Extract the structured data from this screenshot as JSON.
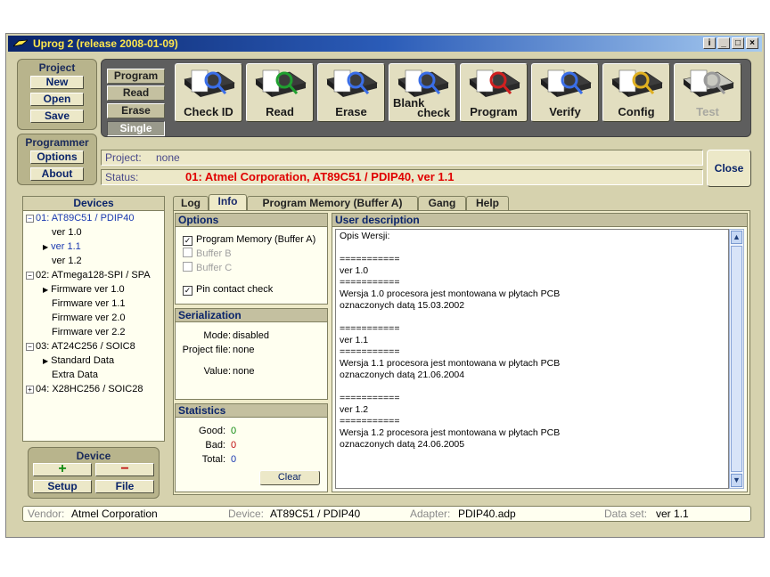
{
  "window": {
    "title": "Uprog 2 (release 2008-01-09)",
    "controls": [
      "i",
      "_",
      "□",
      "×"
    ]
  },
  "project_panel": {
    "header": "Project",
    "buttons": [
      "New",
      "Open",
      "Save"
    ]
  },
  "programmer_panel": {
    "header": "Programmer",
    "buttons": [
      "Options",
      "About"
    ]
  },
  "modes": {
    "items": [
      "Program",
      "Read",
      "Erase",
      "Single"
    ],
    "active": "Single"
  },
  "toolbar": {
    "tools": [
      {
        "label": "Check ID",
        "icon": "chip-magnifier-icon",
        "enabled": true
      },
      {
        "label": "Read",
        "icon": "chip-read-arrow-icon",
        "enabled": true
      },
      {
        "label": "Erase",
        "icon": "chip-eraser-icon",
        "enabled": true
      },
      {
        "label": "Blank check",
        "label_a": "Blank",
        "label_b": "check",
        "icon": "chip-blank-check-icon",
        "enabled": true
      },
      {
        "label": "Program",
        "icon": "chip-program-arrow-icon",
        "enabled": true
      },
      {
        "label": "Verify",
        "icon": "chip-verify-icon",
        "enabled": true
      },
      {
        "label": "Config",
        "icon": "chip-wrench-icon",
        "enabled": true
      },
      {
        "label": "Test",
        "icon": "chip-test-icon",
        "enabled": false
      }
    ]
  },
  "project_line": {
    "label": "Project:",
    "value": "none"
  },
  "status_line": {
    "label": "Status:",
    "value": "01: Atmel Corporation, AT89C51 / PDIP40, ver 1.1",
    "color": "#e00000"
  },
  "close_button": "Close",
  "devices": {
    "header": "Devices",
    "rows": [
      {
        "text": "01: AT89C51 / PDIP40",
        "toggle": "⊟",
        "indent": 0,
        "selected": true
      },
      {
        "text": "ver 1.0",
        "indent": 2
      },
      {
        "text": "ver 1.1",
        "indent": 1,
        "arrow": true,
        "selected": true
      },
      {
        "text": "ver 1.2",
        "indent": 2
      },
      {
        "text": "02: ATmega128-SPI / SPA",
        "toggle": "⊟",
        "indent": 0
      },
      {
        "text": "Firmware ver 1.0",
        "indent": 1,
        "arrow": true
      },
      {
        "text": "Firmware ver 1.1",
        "indent": 2
      },
      {
        "text": "Firmware ver 2.0",
        "indent": 2
      },
      {
        "text": "Firmware ver 2.2",
        "indent": 2
      },
      {
        "text": "03: AT24C256 / SOIC8",
        "toggle": "⊟",
        "indent": 0
      },
      {
        "text": "Standard Data",
        "indent": 1,
        "arrow": true
      },
      {
        "text": "Extra Data",
        "indent": 2
      },
      {
        "text": "04: X28HC256 / SOIC28",
        "toggle": "⊞",
        "indent": 0
      }
    ]
  },
  "device_panel": {
    "header": "Device",
    "add": "+",
    "remove": "−",
    "setup": "Setup",
    "file": "File"
  },
  "tabs": {
    "items": [
      "Log",
      "Info",
      "Program Memory (Buffer A)",
      "Gang",
      "Help"
    ],
    "active": "Info"
  },
  "options": {
    "header": "Options",
    "items": [
      {
        "label": "Program Memory (Buffer A)",
        "checked": true,
        "enabled": true
      },
      {
        "label": "Buffer B",
        "checked": false,
        "enabled": false
      },
      {
        "label": "Buffer C",
        "checked": false,
        "enabled": false
      },
      {
        "label": "Pin contact check",
        "checked": true,
        "enabled": true
      }
    ]
  },
  "serialization": {
    "header": "Serialization",
    "mode_label": "Mode:",
    "mode_value": "disabled",
    "file_label": "Project file:",
    "file_value": "none",
    "value_label": "Value:",
    "value_value": "none"
  },
  "statistics": {
    "header": "Statistics",
    "good_label": "Good:",
    "good_value": "0",
    "bad_label": "Bad:",
    "bad_value": "0",
    "total_label": "Total:",
    "total_value": "0",
    "clear_button": "Clear"
  },
  "user_description": {
    "header": "User description",
    "lines": [
      "Opis Wersji:",
      "",
      "===========",
      "ver 1.0",
      "===========",
      "Wersja 1.0 procesora jest montowana w płytach PCB",
      "oznaczonych datą 15.03.2002",
      "",
      "===========",
      "ver 1.1",
      "===========",
      "Wersja 1.1 procesora jest montowana w płytach PCB",
      "oznaczonych datą 21.06.2004",
      "",
      "===========",
      "ver 1.2",
      "===========",
      "Wersja 1.2 procesora jest montowana w płytach PCB",
      "oznaczonych datą 24.06.2005"
    ]
  },
  "statusbar": {
    "vendor_label": "Vendor:",
    "vendor_value": "Atmel Corporation",
    "device_label": "Device:",
    "device_value": "AT89C51 / PDIP40",
    "adapter_label": "Adapter:",
    "adapter_value": "PDIP40.adp",
    "dataset_label": "Data set:",
    "dataset_value": "ver 1.1"
  }
}
